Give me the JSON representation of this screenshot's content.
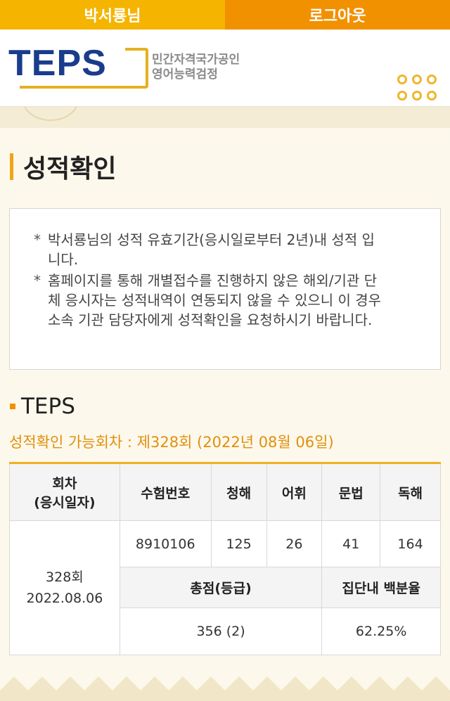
{
  "topbar": {
    "user_label": "박서룡님",
    "logout_label": "로그아웃"
  },
  "header": {
    "logo_text": "TEPS",
    "logo_sub_line1": "민간자격국가공인",
    "logo_sub_line2": "영어능력검정",
    "menu_icon": "grid-menu-icon"
  },
  "page": {
    "title": "성적확인"
  },
  "notice": {
    "items": [
      {
        "bullet": "*",
        "text": "박서룡님의 성적 유효기간(응시일로부터 2년)내 성적 입니다."
      },
      {
        "bullet": "*",
        "text": "홈페이지를 통해 개별접수를 진행하지 않은 해외/기관 단체 응시자는 성적내역이 연동되지 않을 수 있으니 이 경우 소속 기관 담당자에게 성적확인을 요청하시기 바랍니다."
      }
    ]
  },
  "section": {
    "title": "TEPS",
    "available": "성적확인 가능회차 : 제328회 (2022년 08월 06일)"
  },
  "table": {
    "headers": {
      "round_line1": "회차",
      "round_line2": "(응시일자)",
      "exam_no": "수험번호",
      "listening": "청해",
      "vocab": "어휘",
      "grammar": "문법",
      "reading": "독해",
      "total": "총점(등급)",
      "percentile": "집단내 백분율"
    },
    "row": {
      "round": "328회",
      "date": "2022.08.06",
      "exam_no": "8910106",
      "listening": "125",
      "vocab": "26",
      "grammar": "41",
      "reading": "164",
      "total": "356 (2)",
      "percentile": "62.25%"
    }
  },
  "colors": {
    "accent": "#f29100",
    "accent_light": "#f5b400",
    "logo_blue": "#1a3c8c"
  }
}
